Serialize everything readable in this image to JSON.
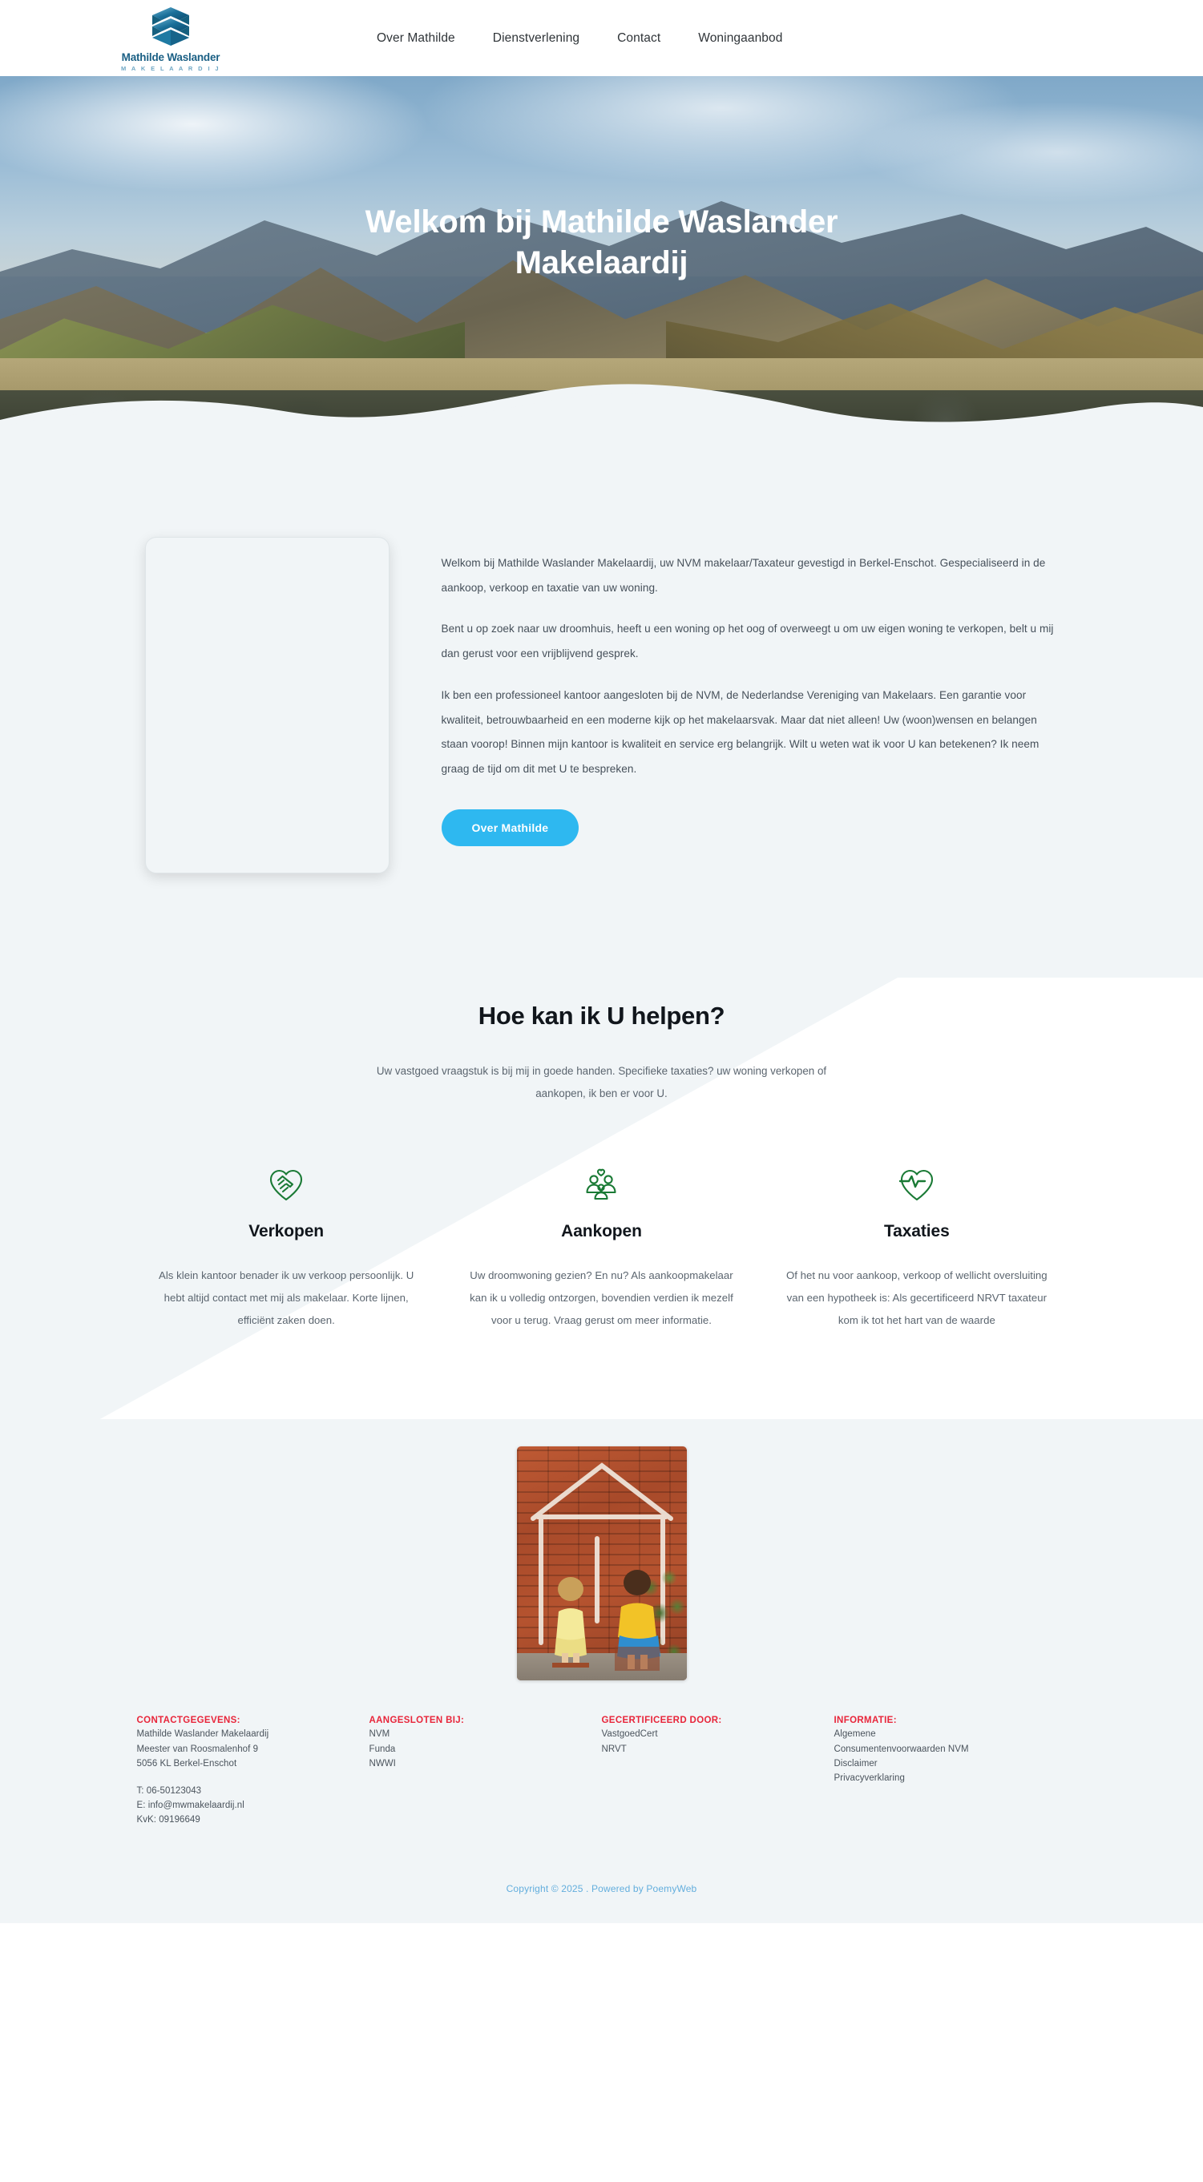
{
  "header": {
    "logo": {
      "name": "Mathilde Waslander",
      "tagline": "M A K E L A A R D I J"
    },
    "nav": [
      {
        "label": "Over Mathilde"
      },
      {
        "label": "Dienstverlening"
      },
      {
        "label": "Contact"
      },
      {
        "label": "Woningaanbod"
      }
    ]
  },
  "hero": {
    "title": "Welkom bij Mathilde Waslander Makelaardij"
  },
  "intro": {
    "paragraphs": [
      "Welkom bij Mathilde Waslander Makelaardij, uw NVM makelaar/Taxateur gevestigd in Berkel-Enschot.\nGespecialiseerd in de aankoop, verkoop en taxatie van uw woning.",
      "Bent u op zoek naar uw droomhuis, heeft u een woning op het oog of overweegt u om uw eigen woning te verkopen, belt u mij dan gerust voor een vrijblijvend gesprek.",
      "Ik ben een professioneel kantoor aangesloten bij de NVM, de Nederlandse Vereniging van Makelaars. Een garantie voor kwaliteit, betrouwbaarheid en een moderne kijk op het makelaarsvak. Maar dat niet alleen! Uw (woon)wensen en belangen staan voorop!\nBinnen mijn kantoor is kwaliteit en service erg belangrijk. Wilt u weten wat ik  voor U kan betekenen? Ik neem graag de tijd om dit met U te bespreken."
    ],
    "cta_label": "Over Mathilde"
  },
  "services": {
    "title": "Hoe kan ik U helpen?",
    "subtitle": "Uw vastgoed vraagstuk is bij mij in goede handen. Specifieke taxaties? uw woning verkopen of aankopen, ik ben er voor U.",
    "accent_color": "#1a7a35",
    "items": [
      {
        "icon": "handshake-heart-icon",
        "title": "Verkopen",
        "text": "Als klein kantoor benader ik uw verkoop persoonlijk. U hebt altijd contact met mij als makelaar. Korte lijnen, efficiënt zaken doen."
      },
      {
        "icon": "family-heart-icon",
        "title": "Aankopen",
        "text": "Uw droomwoning gezien? En nu? Als aankoopmakelaar kan ik u volledig ontzorgen, bovendien verdien ik mezelf voor u terug. Vraag gerust om meer informatie."
      },
      {
        "icon": "heartbeat-icon",
        "title": "Taxaties",
        "text": "Of het nu voor aankoop, verkoop of wellicht oversluiting van een hypotheek is: Als gecertificeerd NRVT taxateur kom ik tot het hart van de waarde"
      }
    ]
  },
  "footer": {
    "heading_color": "#e8253a",
    "columns": [
      {
        "heading": "CONTACTGEGEVENS:",
        "lines_a": [
          "Mathilde Waslander Makelaardij",
          "Meester van Roosmalenhof 9",
          "5056 KL Berkel-Enschot"
        ],
        "lines_b": [
          "T: 06-50123043",
          "E: info@mwmakelaardij.nl",
          "KvK: 09196649"
        ]
      },
      {
        "heading": "AANGESLOTEN BIJ:",
        "lines_a": [
          "NVM",
          "Funda",
          "NWWI"
        ],
        "lines_b": []
      },
      {
        "heading": "GECERTIFICEERD DOOR:",
        "lines_a": [
          "VastgoedCert",
          "NRVT"
        ],
        "lines_b": []
      },
      {
        "heading": "INFORMATIE:",
        "lines_a": [
          "Algemene",
          "Consumentenvoorwaarden NVM",
          "Disclaimer",
          "Privacyverklaring"
        ],
        "lines_b": []
      }
    ]
  },
  "copyright": {
    "text": "Copyright © 2025 . Powered by PoemyWeb",
    "color": "#63aedd"
  }
}
